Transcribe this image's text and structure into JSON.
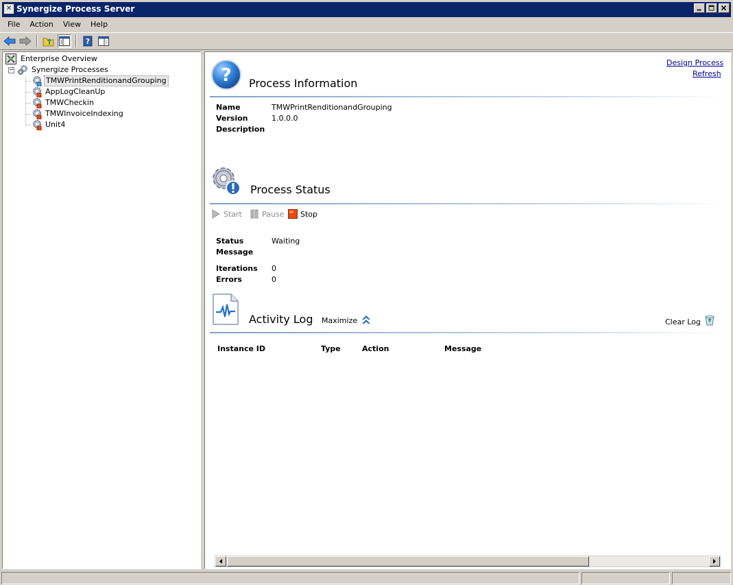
{
  "window": {
    "title": "Synergize Process Server"
  },
  "menu": {
    "items": [
      "File",
      "Action",
      "View",
      "Help"
    ]
  },
  "tree": {
    "root": "Enterprise Overview",
    "group": "Synergize Processes",
    "processes": [
      {
        "label": "TMWPrintRenditionandGrouping",
        "selected": true
      },
      {
        "label": "AppLogCleanUp",
        "selected": false
      },
      {
        "label": "TMWCheckin",
        "selected": false
      },
      {
        "label": "TMWInvoiceIndexing",
        "selected": false
      },
      {
        "label": "Unit4",
        "selected": false
      }
    ]
  },
  "links": {
    "design_process": "Design Process",
    "refresh": "Refresh"
  },
  "process_info": {
    "title": "Process Information",
    "name_label": "Name",
    "name_value": "TMWPrintRenditionandGrouping",
    "version_label": "Version",
    "version_value": "1.0.0.0",
    "description_label": "Description",
    "description_value": ""
  },
  "process_status": {
    "title": "Process Status",
    "start_label": "Start",
    "pause_label": "Pause",
    "stop_label": "Stop",
    "status_label": "Status",
    "status_value": "Waiting",
    "message_label": "Message",
    "message_value": "",
    "iterations_label": "Iterations",
    "iterations_value": "0",
    "errors_label": "Errors",
    "errors_value": "0"
  },
  "activity_log": {
    "title": "Activity Log",
    "maximize_label": "Maximize",
    "clear_log_label": "Clear Log",
    "columns": [
      "Instance ID",
      "Type",
      "Action",
      "Message"
    ]
  },
  "colors": {
    "titlebar": "#0a246a",
    "link": "#00008b",
    "stop": "#e84a14",
    "accent": "#2b6cb8"
  }
}
